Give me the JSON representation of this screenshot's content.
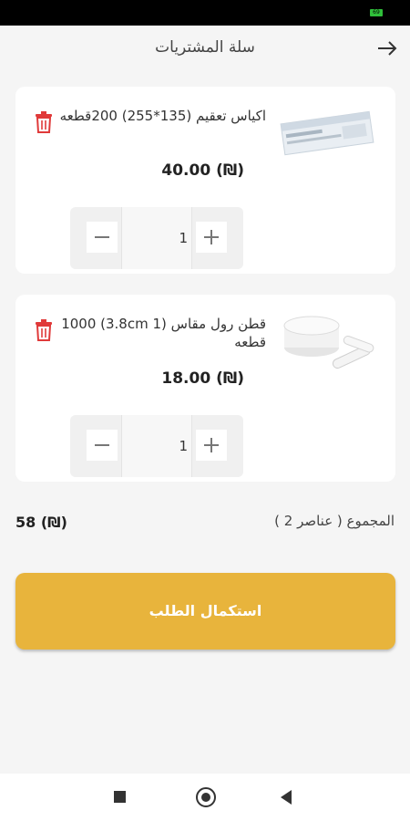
{
  "status_bar": {
    "battery_text": "69"
  },
  "header": {
    "title": "سلة المشتريات",
    "back_icon": "arrow-right-icon"
  },
  "cart": {
    "items": [
      {
        "name": "اكياس تعقيم (135*255) 200قطعه",
        "price": "40.00 (₪)",
        "quantity": "1",
        "image": "sterilization-pouches-image"
      },
      {
        "name": "قطن رول مقاس (1 3.8cm) 1000 قطعه",
        "price": "18.00 (₪)",
        "quantity": "1",
        "image": "cotton-roll-image"
      }
    ]
  },
  "summary": {
    "total_label": "المجموع ( عناصر 2 )",
    "total_value": "58 (₪)"
  },
  "checkout": {
    "label": "استكمال الطلب"
  },
  "colors": {
    "accent": "#e8b43c",
    "delete": "#e03a3a"
  }
}
